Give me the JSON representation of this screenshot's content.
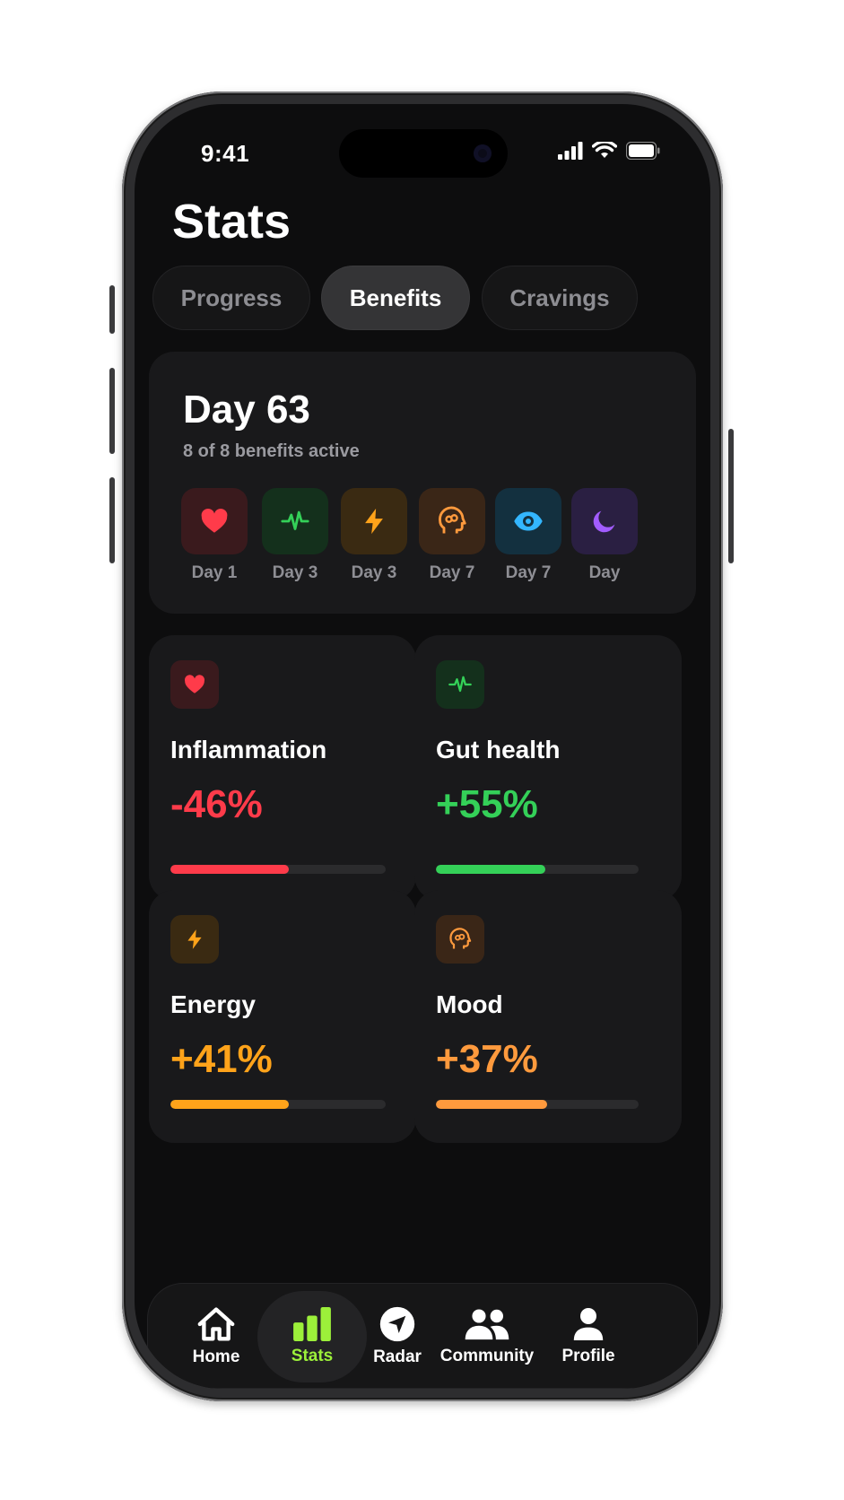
{
  "status": {
    "time": "9:41"
  },
  "page": {
    "title": "Stats"
  },
  "tabs": [
    {
      "label": "Progress",
      "active": false
    },
    {
      "label": "Benefits",
      "active": true
    },
    {
      "label": "Cravings",
      "active": false
    }
  ],
  "summary": {
    "title": "Day 63",
    "subtitle": "8 of 8 benefits active",
    "chips": [
      {
        "icon": "heart-icon",
        "label": "Day 1",
        "color": "#ff3b4a",
        "bg": "#3a1a1d"
      },
      {
        "icon": "pulse-icon",
        "label": "Day 3",
        "color": "#34d058",
        "bg": "#14301c"
      },
      {
        "icon": "bolt-icon",
        "label": "Day 3",
        "color": "#ffa31a",
        "bg": "#3a2a12"
      },
      {
        "icon": "brain-head-icon",
        "label": "Day 7",
        "color": "#ff9a3d",
        "bg": "#3a2617"
      },
      {
        "icon": "eye-icon",
        "label": "Day 7",
        "color": "#33b6ff",
        "bg": "#13303f"
      },
      {
        "icon": "moon-icon",
        "label": "Day",
        "color": "#a25cff",
        "bg": "#2a1f42"
      }
    ]
  },
  "metrics": [
    {
      "icon": "heart-icon",
      "name": "Inflammation",
      "value": "-46%",
      "progress": 0.55,
      "color": "#ff3b4a",
      "bg": "#3a1a1d"
    },
    {
      "icon": "pulse-icon",
      "name": "Gut health",
      "value": "+55%",
      "progress": 0.54,
      "color": "#34d058",
      "bg": "#14301c"
    },
    {
      "icon": "bolt-icon",
      "name": "Energy",
      "value": "+41%",
      "progress": 0.55,
      "color": "#ffa31a",
      "bg": "#3a2a12"
    },
    {
      "icon": "brain-head-icon",
      "name": "Mood",
      "value": "+37%",
      "progress": 0.55,
      "color": "#ff9a3d",
      "bg": "#3a2617"
    }
  ],
  "nav": [
    {
      "icon": "home-icon",
      "label": "Home",
      "active": false
    },
    {
      "icon": "bar-chart-icon",
      "label": "Stats",
      "active": true
    },
    {
      "icon": "navigation-arrow-icon",
      "label": "Radar",
      "active": false
    },
    {
      "icon": "people-icon",
      "label": "Community",
      "active": false
    },
    {
      "icon": "person-icon",
      "label": "Profile",
      "active": false
    }
  ],
  "colors": {
    "accent": "#9cf03a",
    "background": "#0d0d0e",
    "card": "#19191b"
  }
}
